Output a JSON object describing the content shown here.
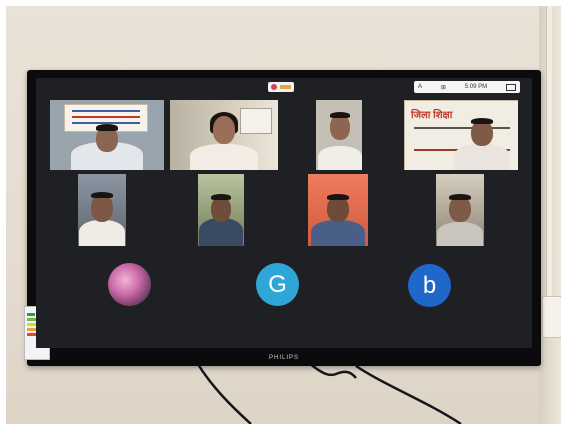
{
  "screen": {
    "status_bar": {
      "indicators": [
        "A",
        "⊞"
      ],
      "time": "5:09 PM"
    }
  },
  "participants": [
    {
      "type": "video",
      "banner": true
    },
    {
      "type": "video"
    },
    {
      "type": "video"
    },
    {
      "type": "video",
      "banner": true,
      "banner_text": "जिला शिक्षा"
    },
    {
      "type": "video"
    },
    {
      "type": "video"
    },
    {
      "type": "video"
    },
    {
      "type": "video"
    },
    {
      "type": "avatar",
      "icon": "flower-photo-icon"
    },
    {
      "type": "avatar",
      "initial": "G",
      "color": "#2ea7d8"
    },
    {
      "type": "avatar",
      "initial": "b",
      "color": "#1f67c9"
    }
  ],
  "tv": {
    "brand": "PHILIPS"
  },
  "colors": {
    "wall": "#e6ded1",
    "bezel": "#0b0b0d",
    "screen": "#1f2024"
  }
}
